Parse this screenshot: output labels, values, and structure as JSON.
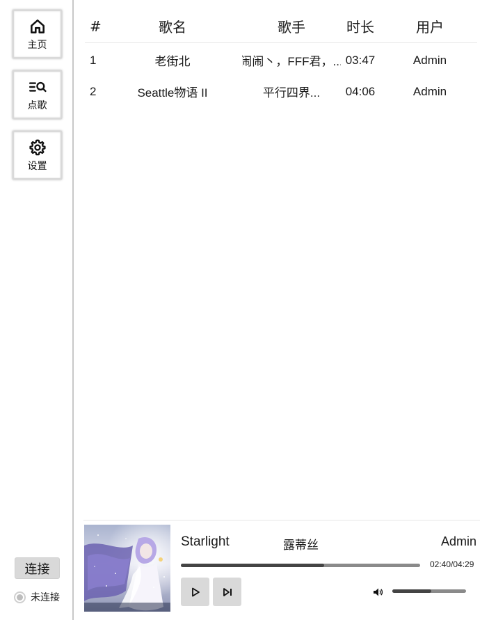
{
  "nav": {
    "home_label": "主页",
    "request_label": "点歌",
    "settings_label": "设置"
  },
  "connection": {
    "button_label": "连接",
    "status_text": "未连接"
  },
  "table": {
    "headers": {
      "num": "#",
      "name": "歌名",
      "artist": "歌手",
      "duration": "时长",
      "user": "用户"
    },
    "rows": [
      {
        "num": "1",
        "name": "老街北",
        "artist": "闹闹丶，FFF君，...",
        "duration": "03:47",
        "user": "Admin"
      },
      {
        "num": "2",
        "name": "Seattle物语 II",
        "artist": "平行四界...",
        "duration": "04:06",
        "user": "Admin"
      }
    ]
  },
  "player": {
    "title": "Starlight",
    "artist": "露蒂丝",
    "user": "Admin",
    "time": "02:40/04:29",
    "progress_fraction": 0.6,
    "volume_fraction": 0.53
  },
  "colors": {
    "accent": "#444444",
    "track": "#8a8a8a",
    "button_bg": "#d9d9d9"
  }
}
